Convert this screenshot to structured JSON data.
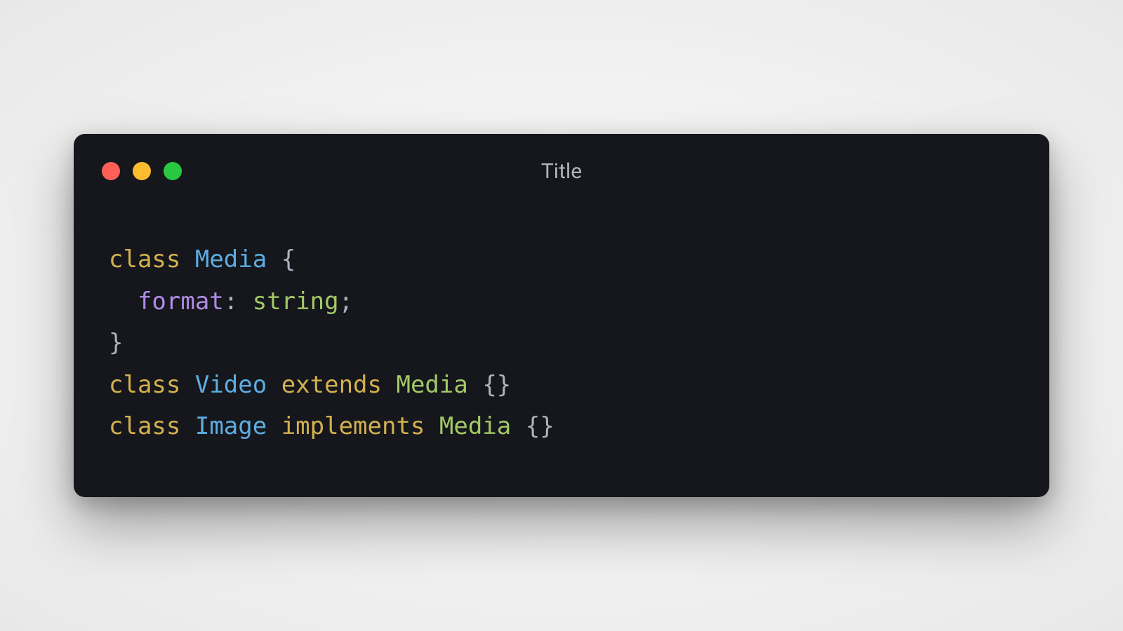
{
  "window": {
    "title": "Title"
  },
  "traffic_lights": {
    "red": "close",
    "yellow": "minimize",
    "green": "maximize"
  },
  "code": {
    "tokens": {
      "kw_class": "class",
      "kw_extends": "extends",
      "kw_implements": "implements",
      "cls_media": "Media",
      "cls_video": "Video",
      "cls_image": "Image",
      "prop_format": "format",
      "type_string": "string",
      "brace_open": "{",
      "brace_close": "}",
      "braces_empty": "{}",
      "colon": ":",
      "semicolon": ";",
      "indent": "  "
    }
  },
  "colors": {
    "background": "#15171c",
    "keyword": "#d4b04f",
    "class_name": "#5dade2",
    "property": "#b18be8",
    "type": "#a3c966",
    "punctuation": "#abb2bf",
    "title_text": "#b0b3b8",
    "traffic_red": "#ff5f57",
    "traffic_yellow": "#febc2e",
    "traffic_green": "#28c840"
  }
}
